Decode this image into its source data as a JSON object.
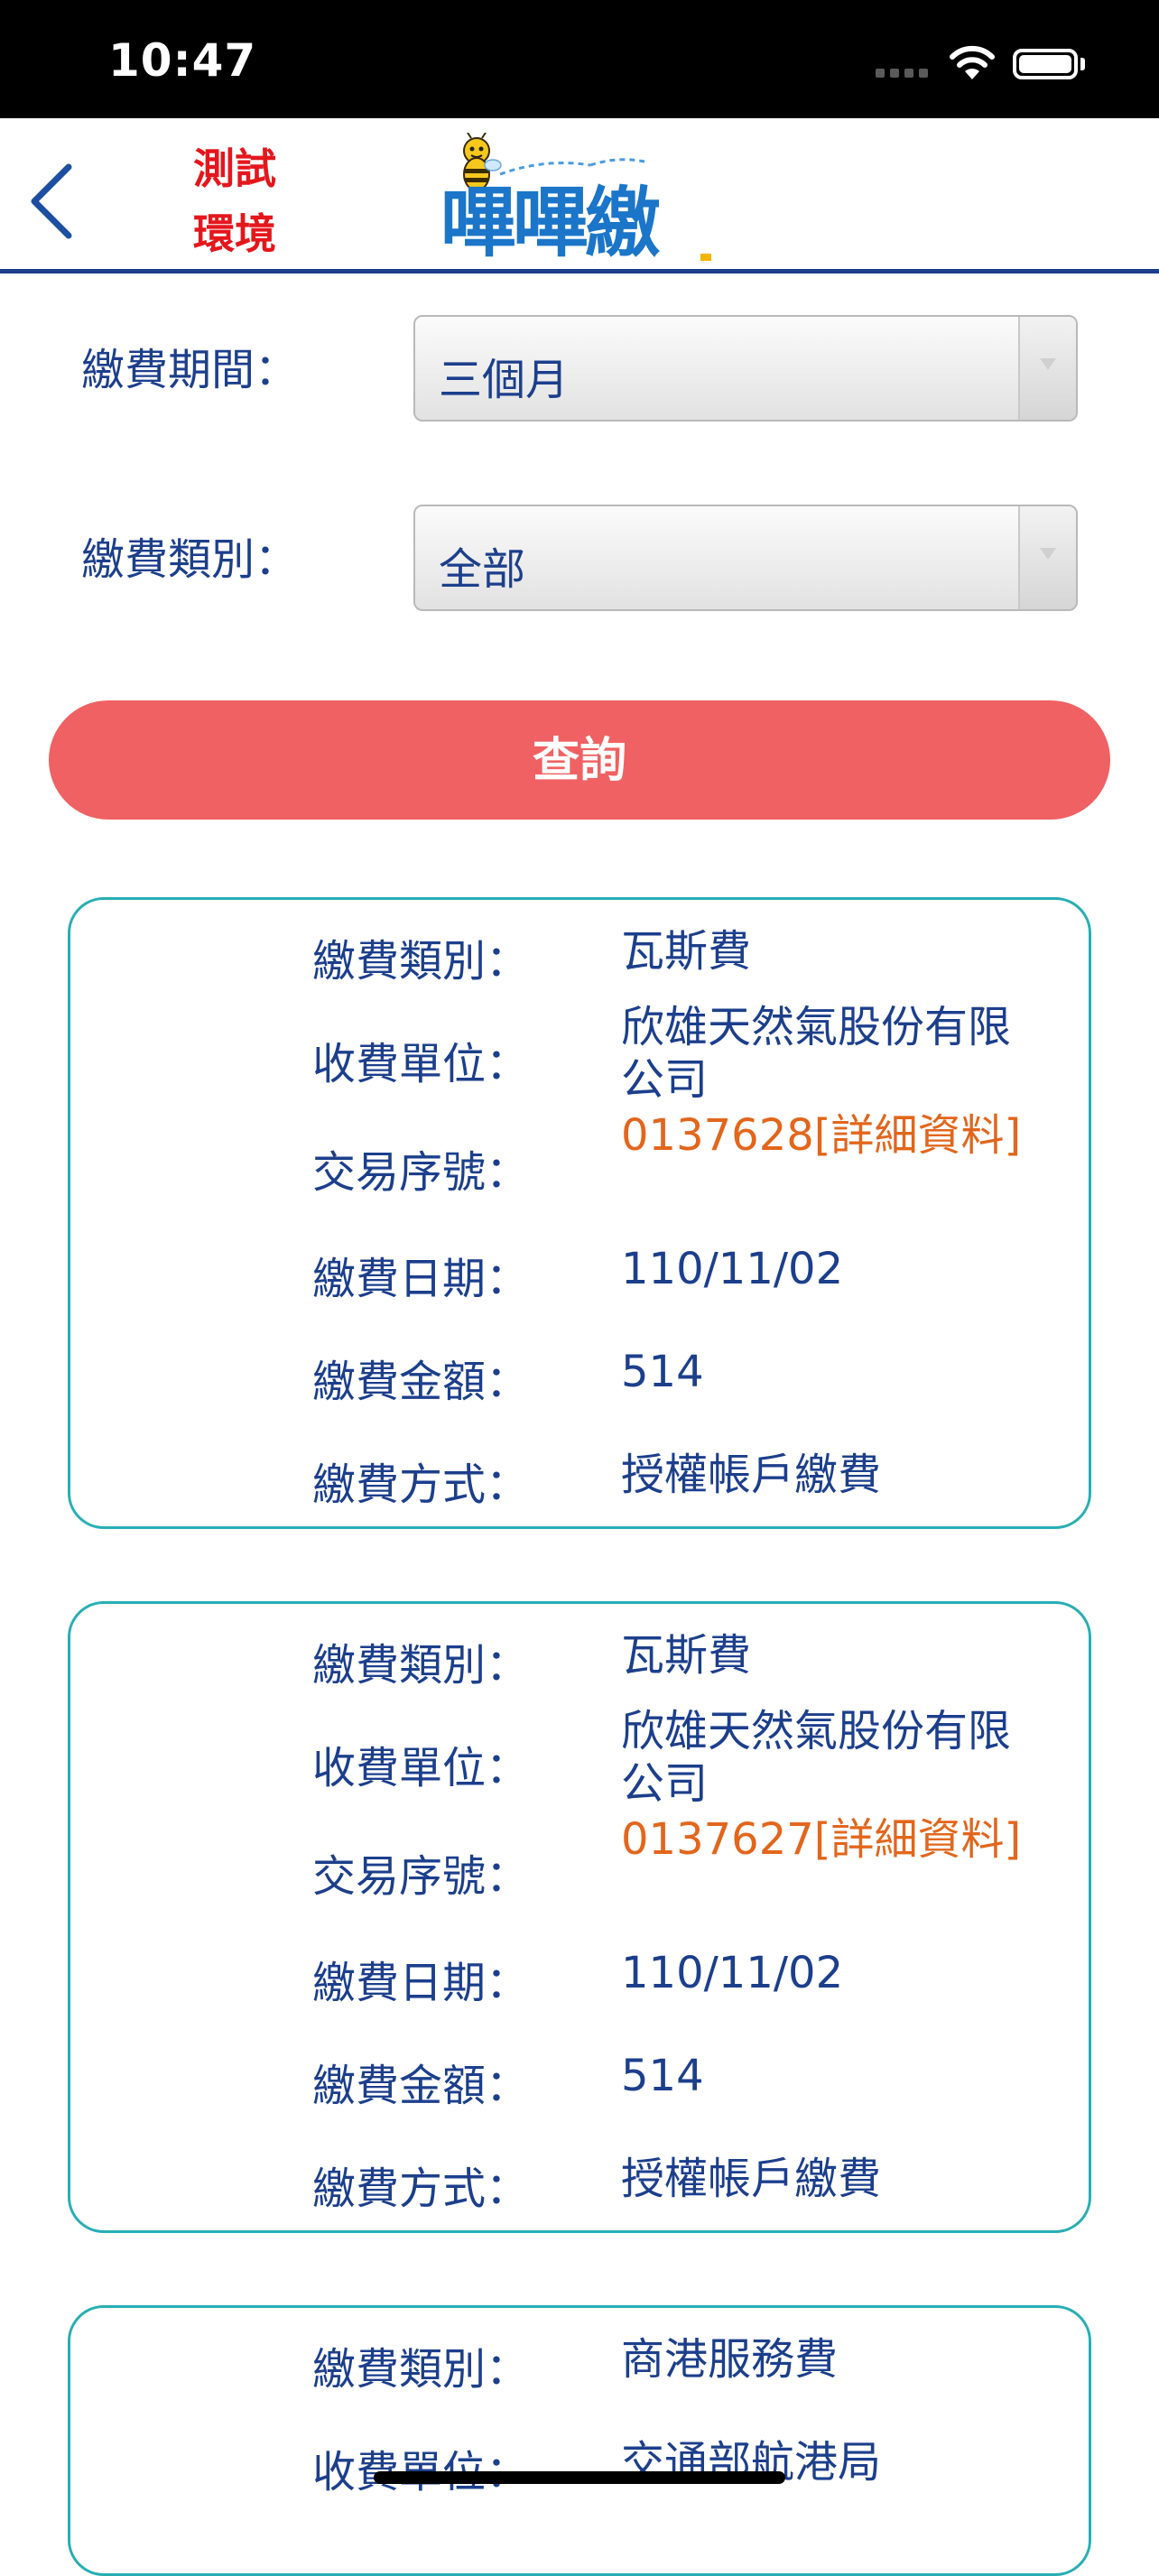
{
  "status_bar": {
    "time": "10:47"
  },
  "header": {
    "env_line1": "測試",
    "env_line2": "環境",
    "logo_text": "嗶嗶繳",
    "colors": {
      "env": "#e4171d",
      "logo": "#1b75c8",
      "rule": "#1d3e8a"
    }
  },
  "form": {
    "period_label": "繳費期間：",
    "period_value": "三個月",
    "type_label": "繳費類別：",
    "type_value": "全部",
    "query_label": "查詢"
  },
  "records": [
    {
      "type_label": "繳費類別：",
      "type": "瓦斯費",
      "unit_label": "收費單位：",
      "unit": "欣雄天然氣股份有限公司",
      "serial_label": "交易序號：",
      "serial": "0137628",
      "detail_link": "[詳細資料]",
      "date_label": "繳費日期：",
      "date": "110/11/02",
      "amount_label": "繳費金額：",
      "amount": "514",
      "method_label": "繳費方式：",
      "method": "授權帳戶繳費"
    },
    {
      "type_label": "繳費類別：",
      "type": "瓦斯費",
      "unit_label": "收費單位：",
      "unit": "欣雄天然氣股份有限公司",
      "serial_label": "交易序號：",
      "serial": "0137627",
      "detail_link": "[詳細資料]",
      "date_label": "繳費日期：",
      "date": "110/11/02",
      "amount_label": "繳費金額：",
      "amount": "514",
      "method_label": "繳費方式：",
      "method": "授權帳戶繳費"
    },
    {
      "type_label": "繳費類別：",
      "type": "商港服務費",
      "unit_label": "收費單位：",
      "unit": "交通部航港局"
    }
  ],
  "colors": {
    "accent_button": "#f06163",
    "card_border": "#27aeb4",
    "text": "#1c3f8c",
    "link": "#e2661c"
  }
}
